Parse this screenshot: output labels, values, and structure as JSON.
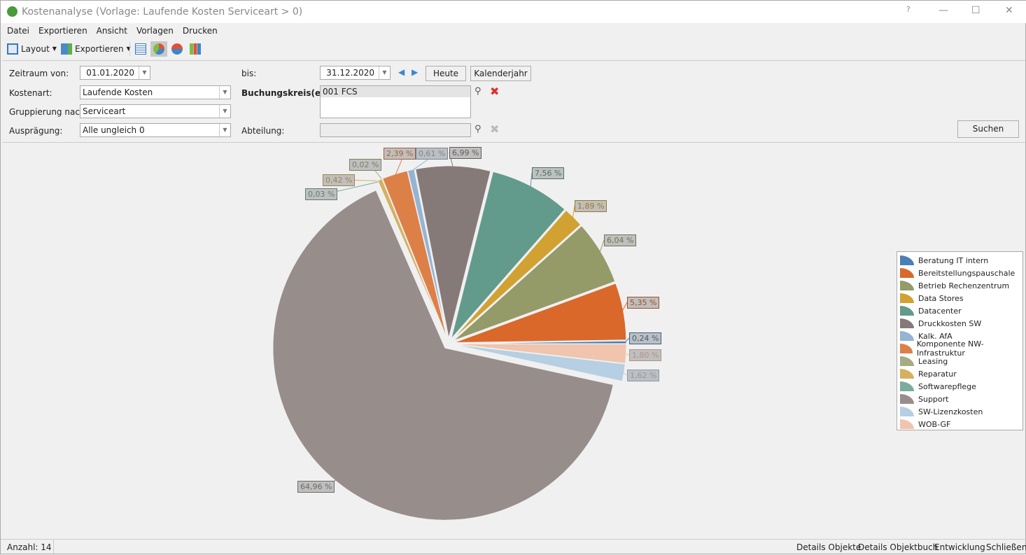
{
  "window": {
    "title": "Kostenanalyse (Vorlage: Laufende Kosten Serviceart > 0)",
    "help": "?",
    "minimize": "—",
    "maximize": "☐",
    "close": "✕"
  },
  "menu": [
    "Datei",
    "Exportieren",
    "Ansicht",
    "Vorlagen",
    "Drucken"
  ],
  "toolbar": {
    "layout": "Layout",
    "export": "Exportieren"
  },
  "filters": {
    "from_label": "Zeitraum von:",
    "from_value": "01.01.2020",
    "to_label": "bis:",
    "to_value": "31.12.2020",
    "today": "Heute",
    "calendar_year": "Kalenderjahr",
    "cost_type_label": "Kostenart:",
    "cost_type_value": "Laufende Kosten",
    "grouping_label": "Gruppierung nach:",
    "grouping_value": "Serviceart",
    "expression_label": "Ausprägung:",
    "expression_value": "Alle ungleich 0",
    "company_label": "Buchungskreis(e):",
    "company_items": [
      "001 FCS"
    ],
    "department_label": "Abteilung:",
    "department_value": "",
    "search": "Suchen"
  },
  "chart_data": {
    "type": "pie",
    "categories": [
      "Beratung IT intern",
      "Bereitstellungspauschale",
      "Betrieb Rechenzentrum",
      "Data Stores",
      "Datacenter",
      "Druckkosten SW",
      "Kalk. AfA",
      "Komponente NW-Infrastruktur",
      "Leasing",
      "Reparatur",
      "Softwarepflege",
      "Support",
      "SW-Lizenzkosten",
      "WOB-GF"
    ],
    "values": [
      0.24,
      5.35,
      6.04,
      1.89,
      7.56,
      6.99,
      0.61,
      2.39,
      0.02,
      0.42,
      0.03,
      64.96,
      1.62,
      1.8
    ],
    "labels": [
      "0,24 %",
      "5,35 %",
      "6,04 %",
      "1,89 %",
      "7,56 %",
      "6,99 %",
      "0,61 %",
      "2,39 %",
      "0,02 %",
      "0,42 %",
      "0,03 %",
      "64,96 %",
      "1,62 %",
      "1,80 %"
    ],
    "colors": [
      "#4a7fb5",
      "#d9682a",
      "#949a68",
      "#d1a132",
      "#629a8c",
      "#857a78",
      "#94b4d4",
      "#dd8048",
      "#a5ab82",
      "#d5b060",
      "#7aab9e",
      "#978d8b",
      "#b6cfe2",
      "#f0c4ad"
    ],
    "legend_position": "right"
  },
  "status": {
    "count": "Anzahl: 14",
    "links": [
      "Details Objekte",
      "Details Objektbuch",
      "Entwicklung",
      "Schließen"
    ]
  }
}
